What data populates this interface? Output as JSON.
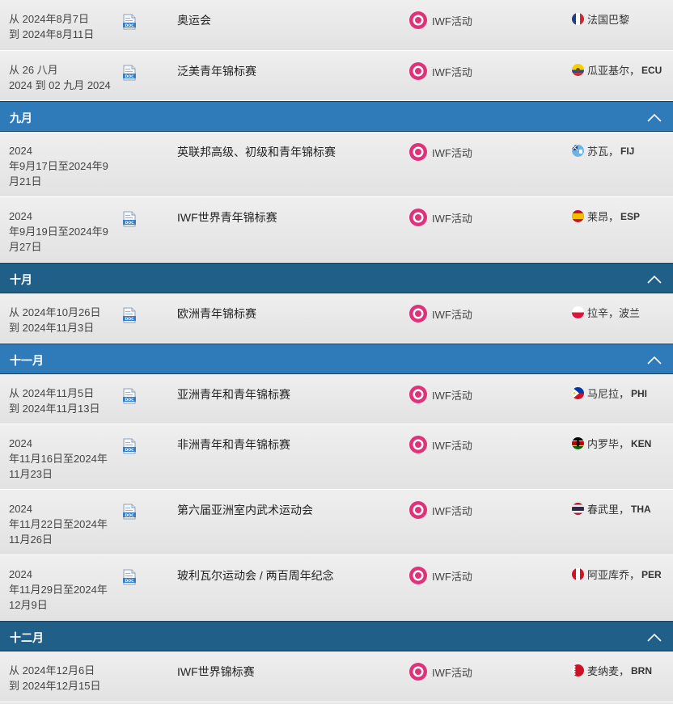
{
  "type_label": "IWF活动",
  "colors": {
    "month_light": "#2f7ab9",
    "month_dark": "#1f5f88",
    "iwf_pink": "#e0327a"
  },
  "sections": [
    {
      "kind": "event",
      "h": 63,
      "date": [
        "从 2024年8月7日",
        "到 2024年8月11日"
      ],
      "doc": true,
      "title": "奥运会",
      "flag": "fra",
      "city": "法国巴黎",
      "code": ""
    },
    {
      "kind": "event",
      "h": 62,
      "date": [
        "从 26 八月",
        "2024 到 02 九月 2024"
      ],
      "doc": true,
      "title": "泛美青年锦标赛",
      "flag": "ecu",
      "city": "瓜亚基尔，",
      "code": "ECU"
    },
    {
      "kind": "month",
      "h": 38,
      "style": "light",
      "name": "九月"
    },
    {
      "kind": "event",
      "h": 81,
      "date": [
        "2024",
        "年9月17日至2024年9",
        "月21日"
      ],
      "doc": false,
      "title": "英联邦高级、初级和青年锦标赛",
      "flag": "fji",
      "city": "苏瓦，",
      "code": "FIJ"
    },
    {
      "kind": "event",
      "h": 81,
      "date": [
        "2024",
        "年9月19日至2024年9",
        "月27日"
      ],
      "doc": true,
      "title": "IWF世界青年锦标赛",
      "flag": "esp",
      "city": "莱昂，",
      "code": "ESP"
    },
    {
      "kind": "month",
      "h": 38,
      "style": "dark",
      "name": "十月"
    },
    {
      "kind": "event",
      "h": 62,
      "date": [
        "从 2024年10月26日",
        "到 2024年11月3日"
      ],
      "doc": true,
      "title": "欧洲青年锦标赛",
      "flag": "pol",
      "city": "拉辛，波兰",
      "code": ""
    },
    {
      "kind": "month",
      "h": 38,
      "style": "light",
      "name": "十一月"
    },
    {
      "kind": "event",
      "h": 62,
      "date": [
        "从 2024年11月5日",
        "到 2024年11月13日"
      ],
      "doc": true,
      "title": "亚洲青年和青年锦标赛",
      "flag": "phi",
      "city": "马尼拉，",
      "code": "PHI"
    },
    {
      "kind": "event",
      "h": 81,
      "date": [
        "2024",
        "年11月16日至2024年",
        "11月23日"
      ],
      "doc": true,
      "title": "非洲青年和青年锦标赛",
      "flag": "ken",
      "city": "内罗毕，",
      "code": "KEN"
    },
    {
      "kind": "event",
      "h": 81,
      "date": [
        "2024",
        "年11月22日至2024年",
        "11月26日"
      ],
      "doc": true,
      "title": "第六届亚洲室内武术运动会",
      "flag": "tha",
      "city": "春武里，",
      "code": "THA"
    },
    {
      "kind": "event",
      "h": 81,
      "date": [
        "2024",
        "年11月29日至2024年",
        "12月9日"
      ],
      "doc": true,
      "title": "玻利瓦尔运动会 / 两百周年纪念",
      "flag": "per",
      "city": "阿亚库乔，",
      "code": "PER"
    },
    {
      "kind": "month",
      "h": 38,
      "style": "dark",
      "name": "十二月"
    },
    {
      "kind": "event",
      "h": 63,
      "date": [
        "从 2024年12月6日",
        "到 2024年12月15日"
      ],
      "doc": false,
      "title": "IWF世界锦标赛",
      "flag": "brn",
      "city": "麦纳麦，",
      "code": "BRN"
    }
  ]
}
